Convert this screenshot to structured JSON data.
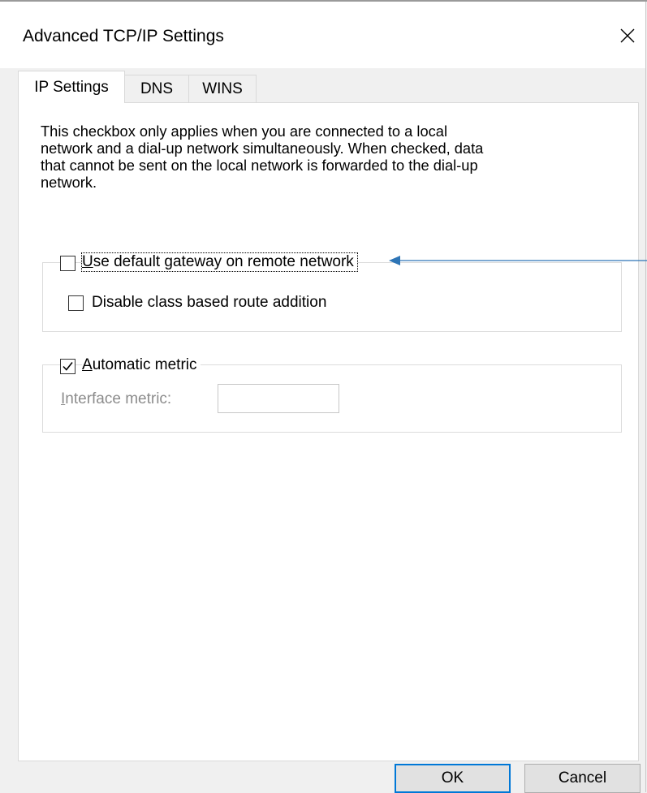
{
  "window": {
    "title": "Advanced TCP/IP Settings",
    "close_icon": "close-icon"
  },
  "tabs": [
    {
      "label": "IP Settings",
      "active": true
    },
    {
      "label": "DNS",
      "active": false
    },
    {
      "label": "WINS",
      "active": false
    }
  ],
  "description": [
    "This checkbox only applies when you are connected to a local",
    "network and a dial-up network simultaneously.  When checked, data",
    "that cannot be sent on the local network is forwarded to the dial-up",
    "network."
  ],
  "gateway_group": {
    "use_default_gateway": {
      "label": "Use default gateway on remote network",
      "checked": false
    },
    "disable_class_route": {
      "label": "Disable class based route addition",
      "checked": false
    }
  },
  "metric_group": {
    "automatic_metric": {
      "label": "Automatic metric",
      "checked": true
    },
    "interface_metric_label": "Interface metric:",
    "interface_metric_value": ""
  },
  "buttons": {
    "ok": "OK",
    "cancel": "Cancel"
  },
  "annotation": {
    "arrow_color": "#2e75b6"
  }
}
